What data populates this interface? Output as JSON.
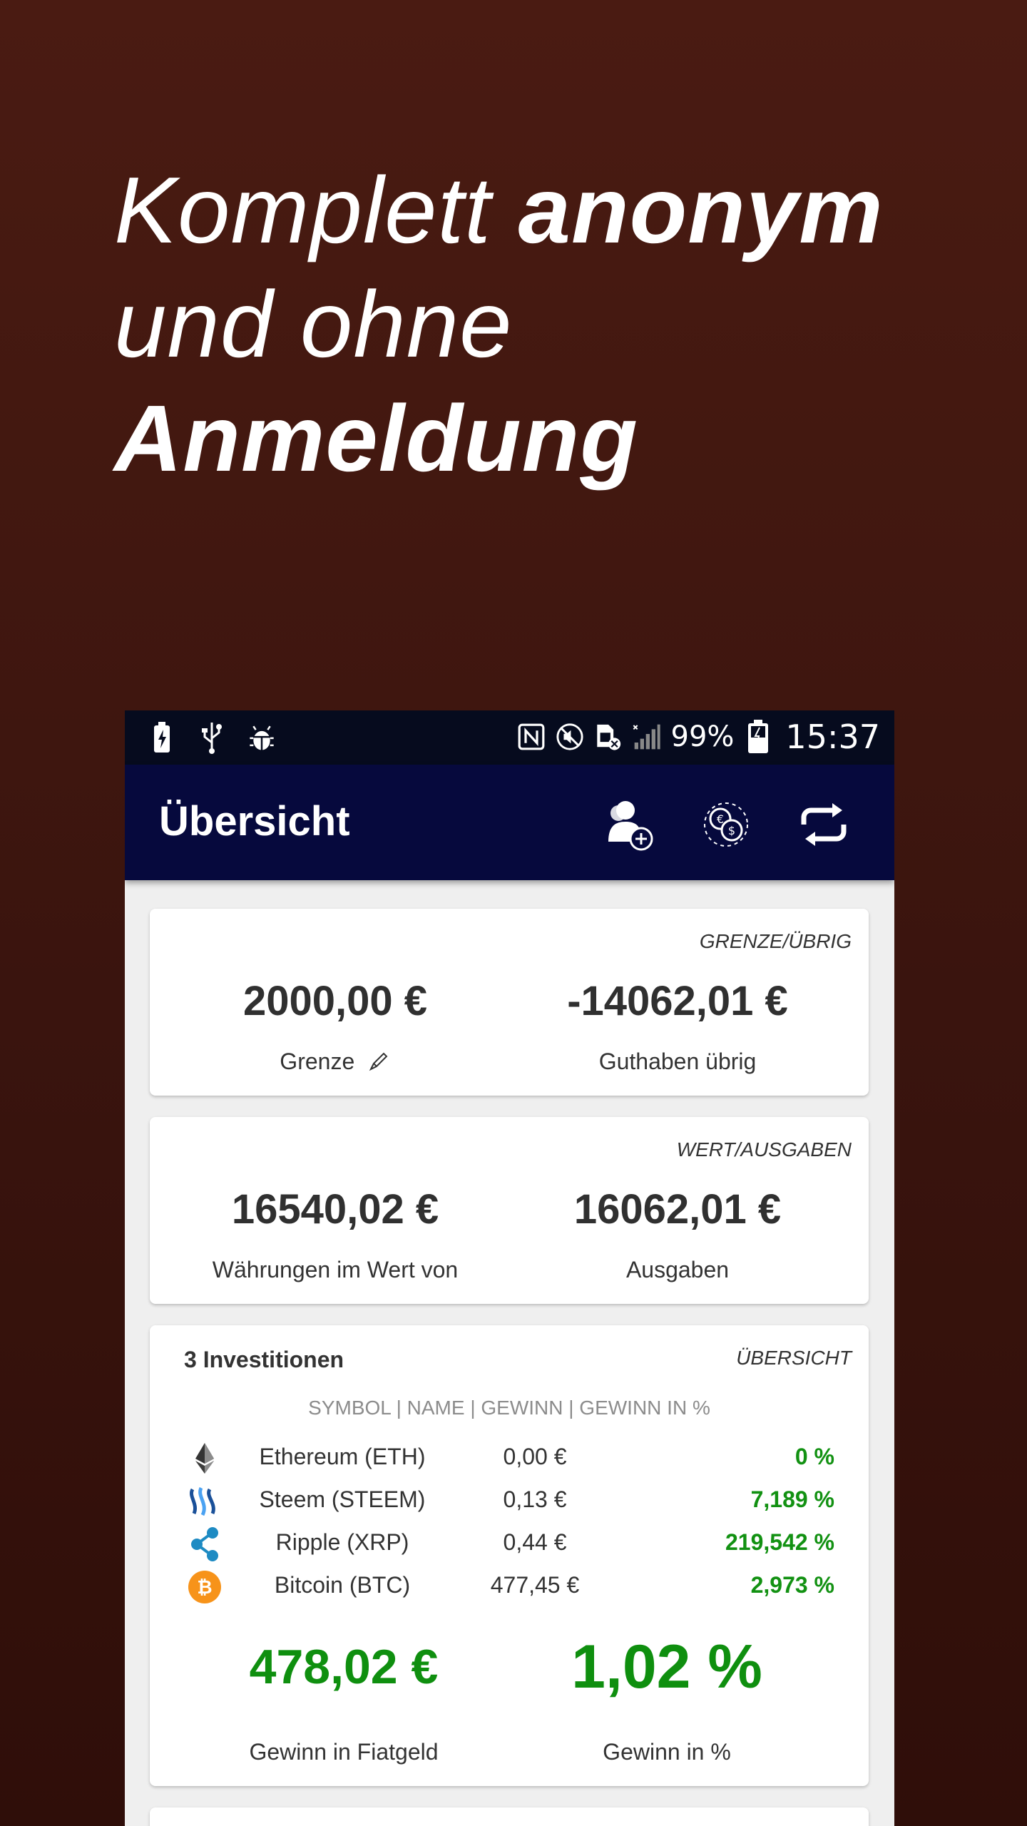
{
  "promo": {
    "line1_normal": "Komplett ",
    "line1_bold": "anonym",
    "line2": "und ohne",
    "line3": "Anmeldung"
  },
  "statusbar": {
    "battery_pct": "99%",
    "time": "15:37",
    "icons": [
      "battery-charging-icon",
      "usb-icon",
      "debug-icon",
      "nfc-icon",
      "mute-icon",
      "sim-off-icon",
      "signal-icon",
      "battery-icon"
    ]
  },
  "appbar": {
    "title": "Übersicht",
    "actions": [
      "add-user-icon",
      "currency-exchange-icon",
      "refresh-icon"
    ]
  },
  "limit_card": {
    "tag": "GRENZE/ÜBRIG",
    "limit_value": "2000,00 €",
    "limit_label": "Grenze",
    "remaining_value": "-14062,01 €",
    "remaining_label": "Guthaben übrig"
  },
  "value_card": {
    "tag": "WERT/AUSGABEN",
    "worth_value": "16540,02 €",
    "worth_label": "Währungen im Wert von",
    "spent_value": "16062,01 €",
    "spent_label": "Ausgaben"
  },
  "investments": {
    "title": "3 Investitionen",
    "tag": "ÜBERSICHT",
    "header": "SYMBOL | NAME | GEWINN | GEWINN IN %",
    "rows": [
      {
        "icon": "ethereum-icon",
        "name": "Ethereum (ETH)",
        "gain": "0,00 €",
        "percent": "0 %"
      },
      {
        "icon": "steem-icon",
        "name": "Steem (STEEM)",
        "gain": "0,13 €",
        "percent": "7,189 %"
      },
      {
        "icon": "ripple-icon",
        "name": "Ripple (XRP)",
        "gain": "0,44 €",
        "percent": "219,542 %"
      },
      {
        "icon": "bitcoin-icon",
        "name": "Bitcoin (BTC)",
        "gain": "477,45 €",
        "percent": "2,973 %"
      }
    ],
    "total_fiat": "478,02 €",
    "total_fiat_label": "Gewinn in Fiatgeld",
    "total_pct": "1,02 %",
    "total_pct_label": "Gewinn in %"
  },
  "colors": {
    "background": "#3f160f",
    "appbar": "#06093d",
    "statusbar": "#060b1e",
    "gain_green": "#129112"
  }
}
